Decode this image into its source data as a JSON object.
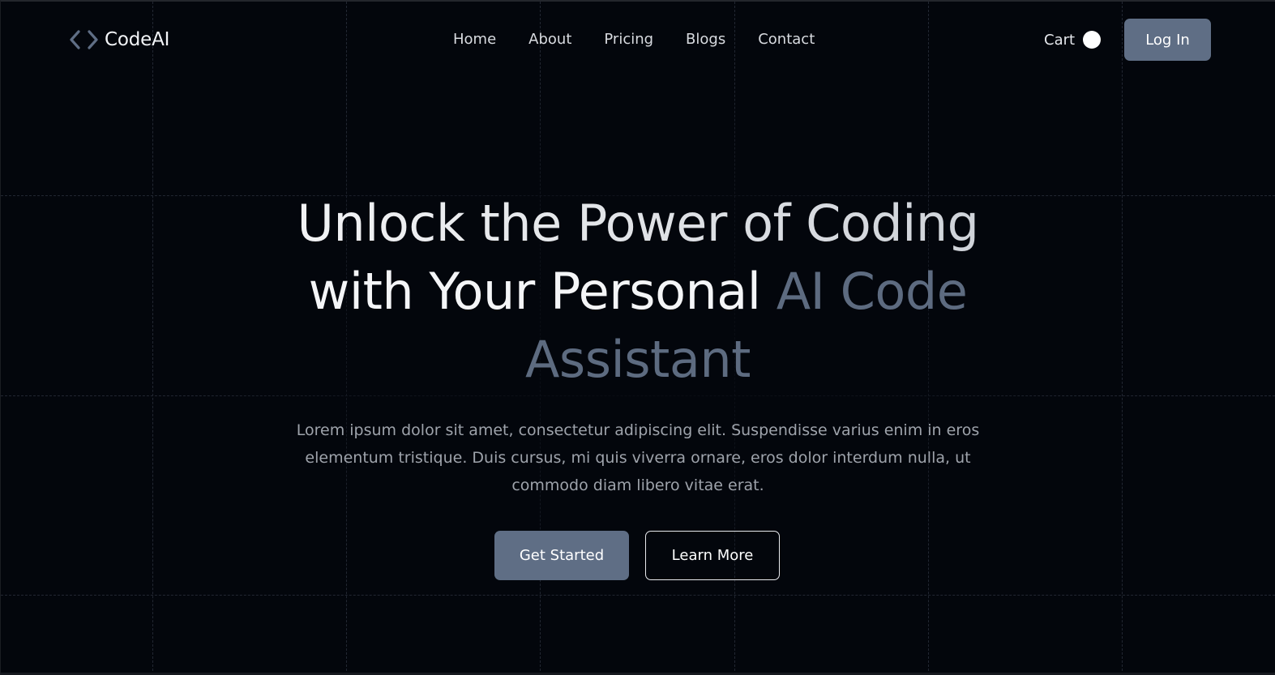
{
  "nav": {
    "logo_text": "CodeAI",
    "logo_icon": "code-brackets-icon",
    "links": [
      "Home",
      "About",
      "Pricing",
      "Blogs",
      "Contact"
    ],
    "cart_label": "Cart",
    "login_label": "Log In"
  },
  "hero": {
    "title_line1": "Unlock the Power of Coding",
    "title_line2_plain": "with Your Personal ",
    "title_line2_accent": "AI Code",
    "title_line3_accent": "Assistant",
    "description": "Lorem ipsum dolor sit amet, consectetur adipiscing elit. Suspendisse varius enim in eros elementum tristique. Duis cursus, mi quis viverra ornare, eros dolor interdum nulla, ut commodo diam libero vitae erat.",
    "primary_cta": "Get Started",
    "secondary_cta": "Learn More"
  },
  "colors": {
    "background": "#03060c",
    "accent": "#5f6e85",
    "accent_text": "#5d6b80",
    "grid_line": "#222732"
  }
}
